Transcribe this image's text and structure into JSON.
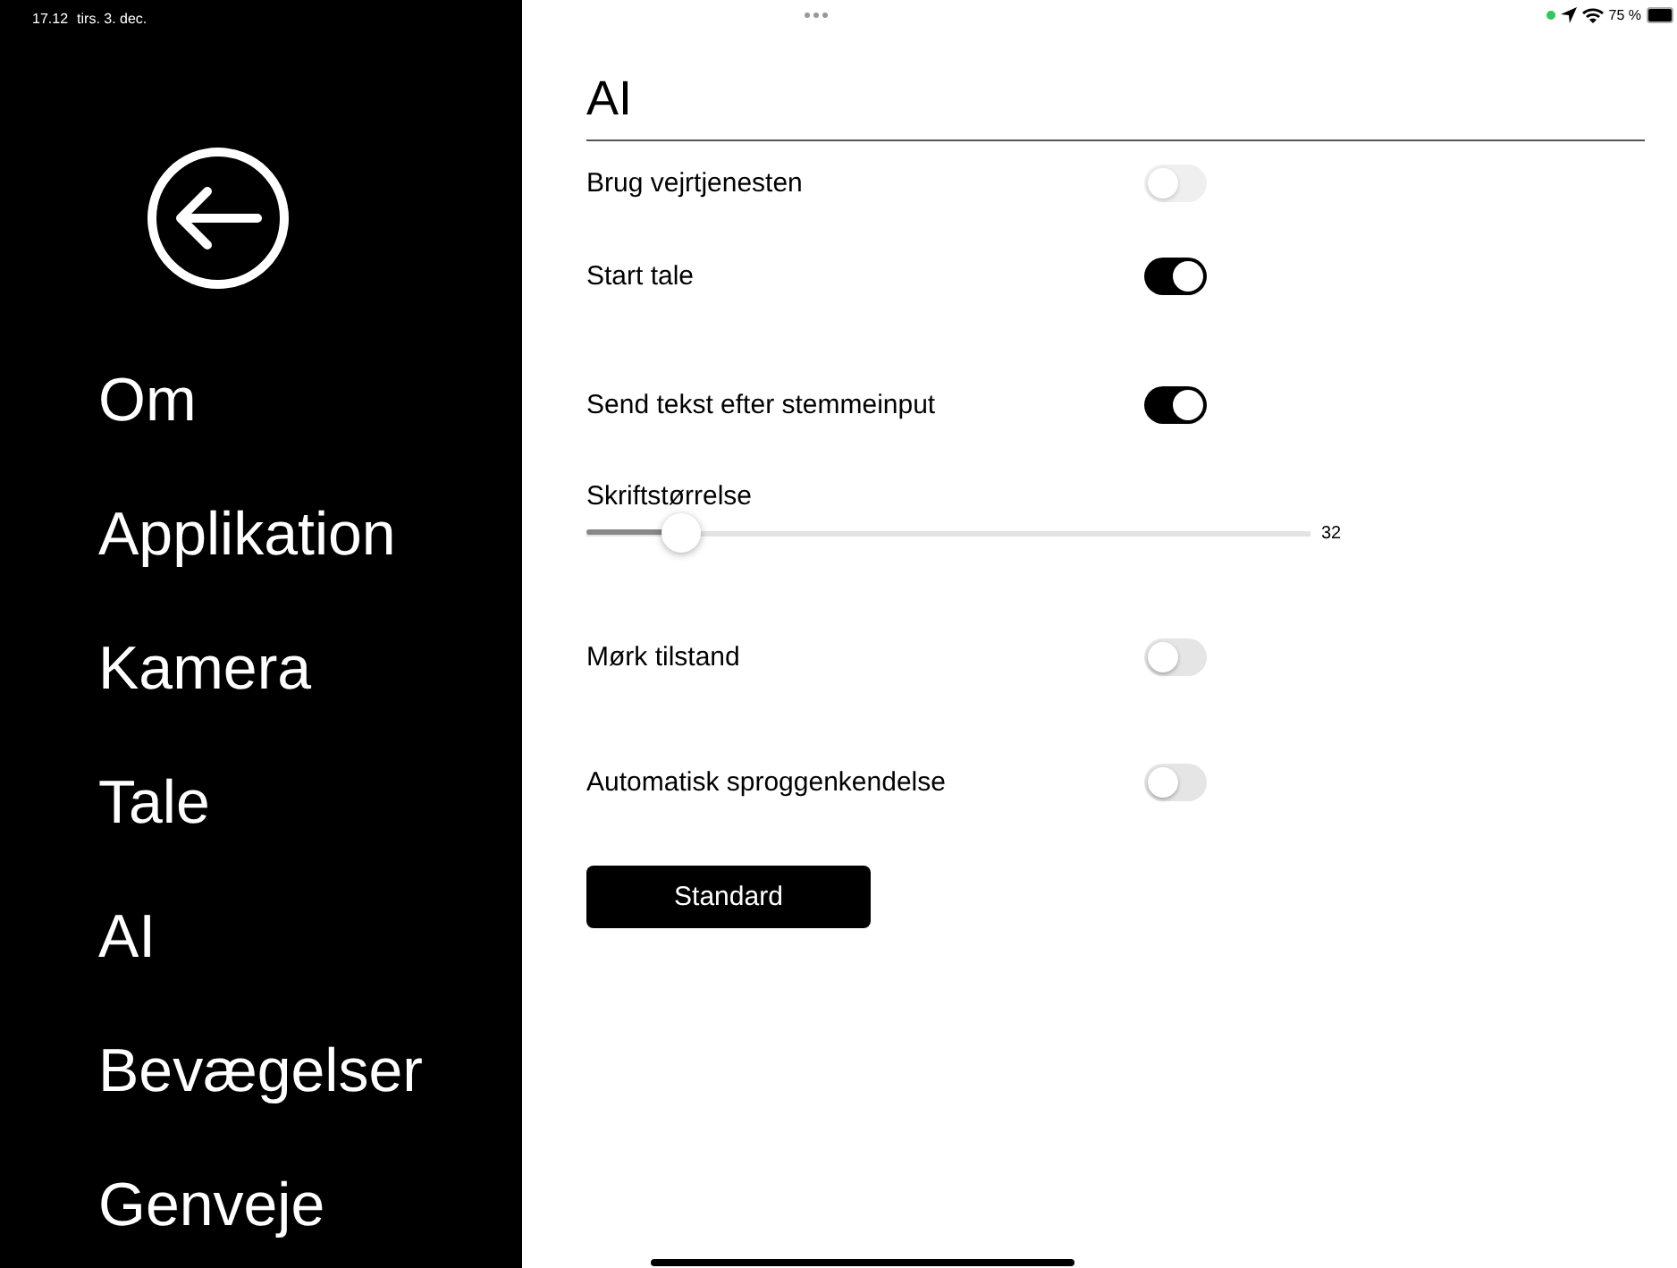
{
  "status_bar": {
    "time": "17.12",
    "date": "tirs. 3. dec.",
    "battery": "75 %"
  },
  "sidebar": {
    "items": [
      "Om",
      "Applikation",
      "Kamera",
      "Tale",
      "AI",
      "Bevægelser",
      "Genveje"
    ]
  },
  "page": {
    "title": "AI"
  },
  "settings": [
    {
      "kind": "toggle",
      "label": "Brug vejrtjenesten",
      "on": false,
      "disabled": true
    },
    {
      "kind": "toggle",
      "label": "Start tale",
      "on": true,
      "disabled": false
    },
    {
      "kind": "toggle",
      "label": "Send tekst efter stemmeinput",
      "on": true,
      "disabled": false
    },
    {
      "kind": "slider",
      "label": "Skriftstørrelse",
      "level": 0.13,
      "reading": "32"
    },
    {
      "kind": "toggle",
      "label": "Mørk tilstand",
      "on": false,
      "disabled": false
    },
    {
      "kind": "toggle",
      "label": "Automatisk sproggenkendelse",
      "on": false,
      "disabled": false
    }
  ],
  "reset_button": "Standard"
}
